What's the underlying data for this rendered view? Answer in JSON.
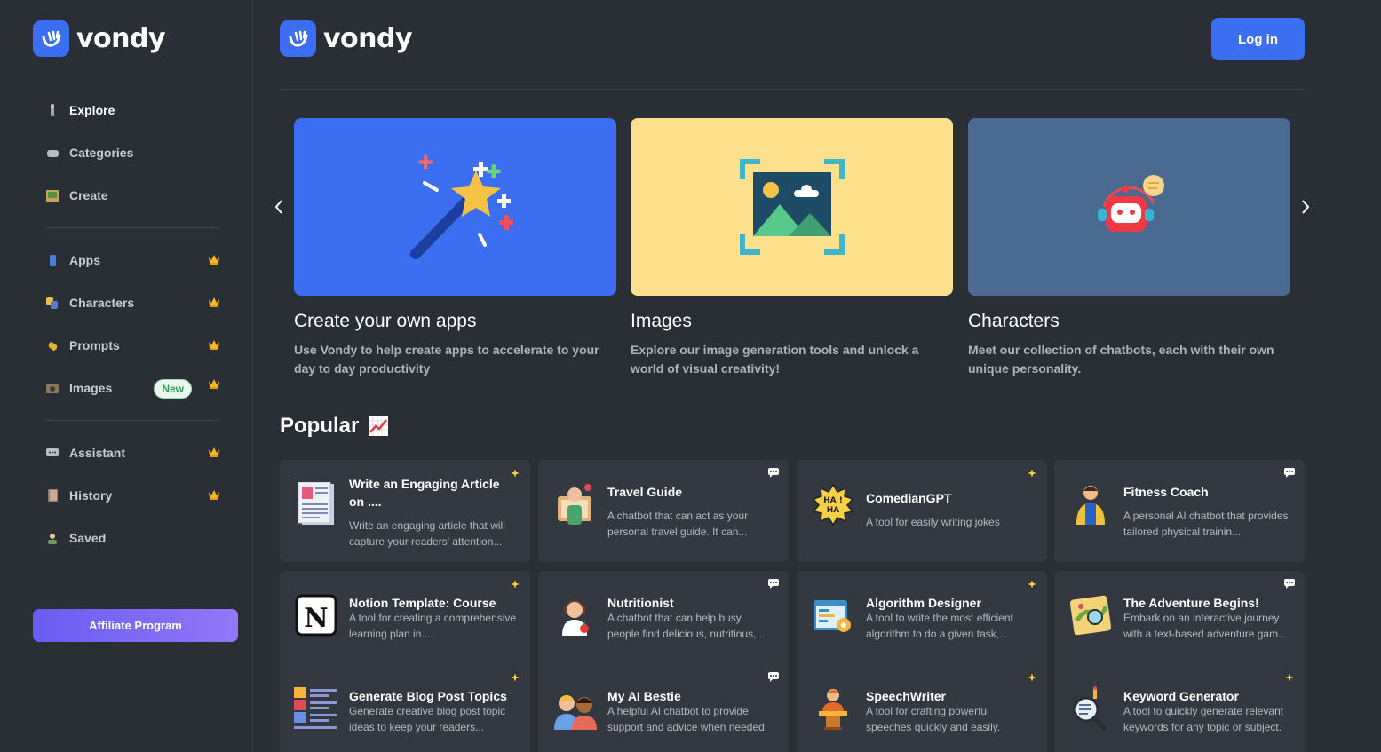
{
  "brand": {
    "name": "vondy"
  },
  "sidebar": {
    "items": [
      {
        "label": "Explore",
        "icon": "explore-icon"
      },
      {
        "label": "Categories",
        "icon": "categories-icon"
      },
      {
        "label": "Create",
        "icon": "create-icon"
      },
      {
        "label": "Apps",
        "icon": "apps-icon"
      },
      {
        "label": "Characters",
        "icon": "characters-icon"
      },
      {
        "label": "Prompts",
        "icon": "prompts-icon"
      },
      {
        "label": "Images",
        "icon": "images-icon",
        "badge": "New"
      },
      {
        "label": "Assistant",
        "icon": "assistant-icon"
      },
      {
        "label": "History",
        "icon": "history-icon"
      },
      {
        "label": "Saved",
        "icon": "saved-icon"
      }
    ],
    "affiliate_label": "Affiliate Program"
  },
  "header": {
    "login_label": "Log in"
  },
  "features": [
    {
      "title": "Create your own apps",
      "desc": "Use Vondy to help create apps to accelerate to your day to day productivity",
      "color": "#3b6ef0"
    },
    {
      "title": "Images",
      "desc": "Explore our image generation tools and unlock a world of visual creativity!",
      "color": "#fde08b"
    },
    {
      "title": "Characters",
      "desc": "Meet our collection of chatbots, each with their own unique personality.",
      "color": "#4a6a92"
    }
  ],
  "popular": {
    "title": "Popular",
    "cards": [
      {
        "title": "Write an Engaging Article on ....",
        "desc": "Write an engaging article that will capture your readers' attention...",
        "type": "app"
      },
      {
        "title": "Travel Guide",
        "desc": "A chatbot that can act as your personal travel guide. It can...",
        "type": "chat"
      },
      {
        "title": "ComedianGPT",
        "desc": "A tool for easily writing jokes",
        "type": "app"
      },
      {
        "title": "Fitness Coach",
        "desc": "A personal AI chatbot that provides tailored physical trainin...",
        "type": "chat"
      },
      {
        "title": "Notion Template: Course",
        "desc": "A tool for creating a comprehensive learning plan in...",
        "type": "app"
      },
      {
        "title": "Nutritionist",
        "desc": "A chatbot that can help busy people find delicious, nutritious,...",
        "type": "chat"
      },
      {
        "title": "Algorithm Designer",
        "desc": "A tool to write the most efficient algorithm to do a given task,...",
        "type": "app"
      },
      {
        "title": "The Adventure Begins!",
        "desc": "Embark on an interactive journey with a text-based adventure gam...",
        "type": "chat"
      },
      {
        "title": "Generate Blog Post Topics",
        "desc": "Generate creative blog post topic ideas to keep your readers...",
        "type": "app"
      },
      {
        "title": "My AI Bestie",
        "desc": "A helpful AI chatbot to provide support and advice when needed.",
        "type": "chat"
      },
      {
        "title": "SpeechWriter",
        "desc": "A tool for crafting powerful speeches quickly and easily.",
        "type": "app"
      },
      {
        "title": "Keyword Generator",
        "desc": "A tool to quickly generate relevant keywords for any topic or subject.",
        "type": "app"
      }
    ]
  }
}
